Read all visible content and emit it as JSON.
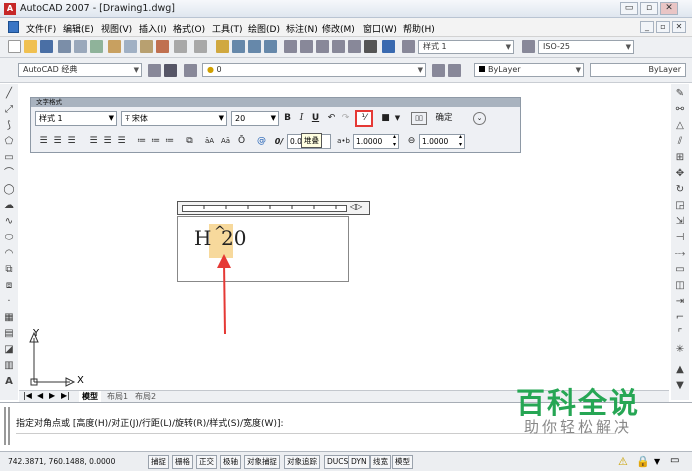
{
  "window": {
    "title": "AutoCAD 2007 - [Drawing1.dwg]",
    "logo": "A",
    "controls": [
      "▭",
      "▫",
      "✕"
    ],
    "doc_controls": [
      "_",
      "▫",
      "✕"
    ]
  },
  "menu": {
    "items": [
      "文件(F)",
      "编辑(E)",
      "视图(V)",
      "插入(I)",
      "格式(O)",
      "工具(T)",
      "绘图(D)",
      "标注(N)",
      "修改(M)",
      "窗口(W)",
      "帮助(H)"
    ]
  },
  "toolbar1": {
    "text_style_value": "样式 1",
    "dim_style_value": "ISO-25"
  },
  "toolbar2": {
    "workspace_value": "AutoCAD 经典",
    "layer_value": "0",
    "color_value": "ByLayer",
    "linetype_value": "ByLayer"
  },
  "text_formatting": {
    "title": "文字格式",
    "style_value": "样式 1",
    "font_value": "宋体",
    "height_value": "20",
    "bold_label": "B",
    "italic_label": "I",
    "underline_label": "U",
    "ok_label": "确定",
    "oblique_value": "0.0000",
    "tracking_value": "1.0000",
    "width_value": "1.0000",
    "stack_tooltip": "堆叠",
    "sym_at": "@",
    "sym_slash": "0/"
  },
  "editor": {
    "text_before": "H",
    "caret": "^",
    "text_after": "20",
    "ruler_end": "◁▷"
  },
  "tabs": {
    "model": "模型",
    "layout1": "布局1",
    "layout2": "布局2"
  },
  "ucs": {
    "x": "X",
    "y": "Y"
  },
  "command": {
    "prompt": "指定对角点或 [高度(H)/对正(J)/行距(L)/旋转(R)/样式(S)/宽度(W)]:"
  },
  "status": {
    "coords": "742.3871, 760.1488, 0.0000",
    "buttons": [
      "捕捉",
      "栅格",
      "正交",
      "极轴",
      "对象捕捉",
      "对象追踪",
      "DUCS",
      "DYN",
      "线宽",
      "模型"
    ]
  },
  "watermark": {
    "main": "百科全说",
    "sub": "助你轻松解决"
  },
  "colors": {
    "accent_red": "#e53935",
    "highlight": "#f7d99c",
    "watermark_green": "#26a654"
  }
}
